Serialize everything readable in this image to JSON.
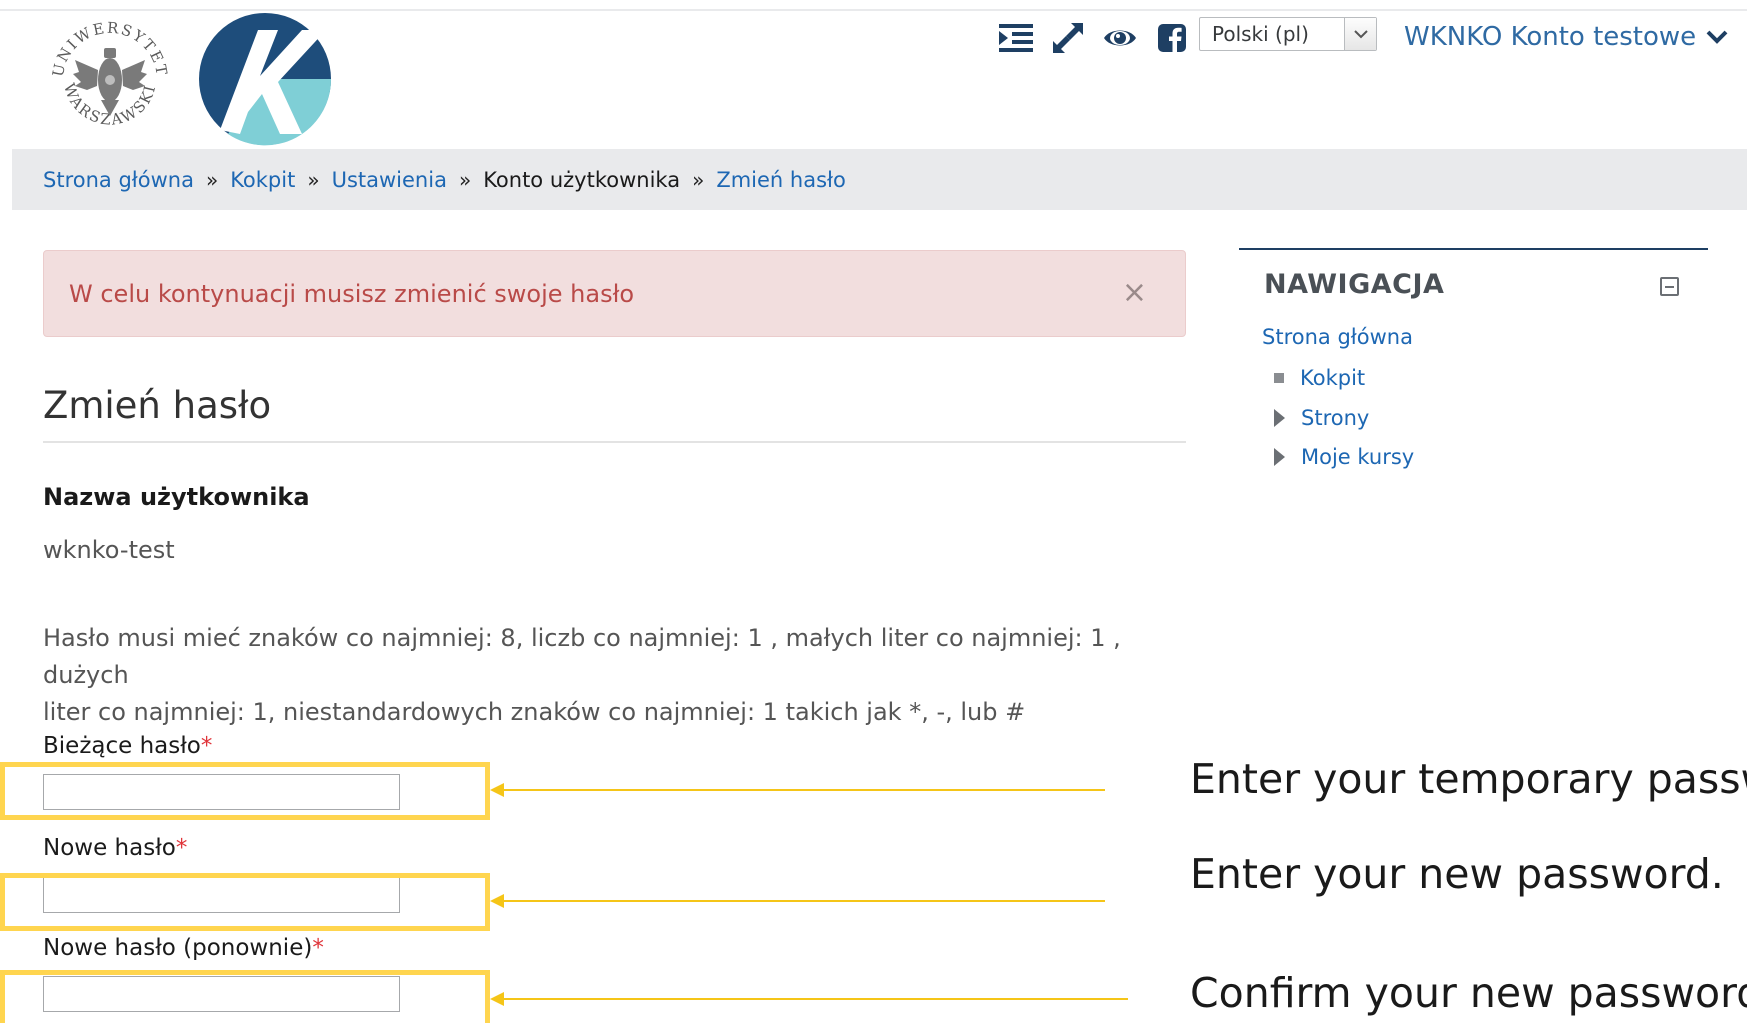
{
  "header": {
    "language_selected": "Polski (pl)",
    "user_name": "WKNKO Konto testowe",
    "logos": {
      "uw_top": "UNIWERSYTET",
      "uw_bottom": "WARSZAWSKI",
      "k_letter": "K"
    },
    "colors": {
      "uw_logo": "#555555",
      "k_dark": "#1e4d7b",
      "k_light": "#7fcfd6"
    }
  },
  "breadcrumb": {
    "items": [
      "Strona główna",
      "Kokpit",
      "Ustawienia",
      "Konto użytkownika",
      "Zmień hasło"
    ],
    "separator": "»"
  },
  "alert": {
    "message": "W celu kontynuacji musisz zmienić swoje hasło",
    "close": "×"
  },
  "page": {
    "title": "Zmień hasło",
    "username_label": "Nazwa użytkownika",
    "username_value": "wknko-test",
    "policy_line1": "Hasło musi mieć znaków co najmniej: 8, liczb co najmniej: 1 , małych liter co najmniej: 1 , dużych",
    "policy_line2": "liter co najmniej: 1, niestandardowych znaków co najmniej: 1 takich jak *, -, lub #",
    "fields": [
      {
        "label": "Bieżące hasło",
        "required": "*",
        "value": ""
      },
      {
        "label": "Nowe hasło",
        "required": "*",
        "value": ""
      },
      {
        "label": "Nowe hasło (ponownie)",
        "required": "*",
        "value": ""
      }
    ]
  },
  "annotations": [
    "Enter your temporary passw",
    "Enter your new password.",
    "Confirm your new password."
  ],
  "navigation": {
    "title": "NAWIGACJA",
    "home": "Strona główna",
    "items": [
      "Kokpit",
      "Strony",
      "Moje kursy"
    ]
  },
  "colors": {
    "link": "#1d67b3",
    "alert_bg": "#f2dede",
    "alert_text": "#b94a48",
    "highlight": "#ffd54f",
    "required": "#e0343a"
  }
}
